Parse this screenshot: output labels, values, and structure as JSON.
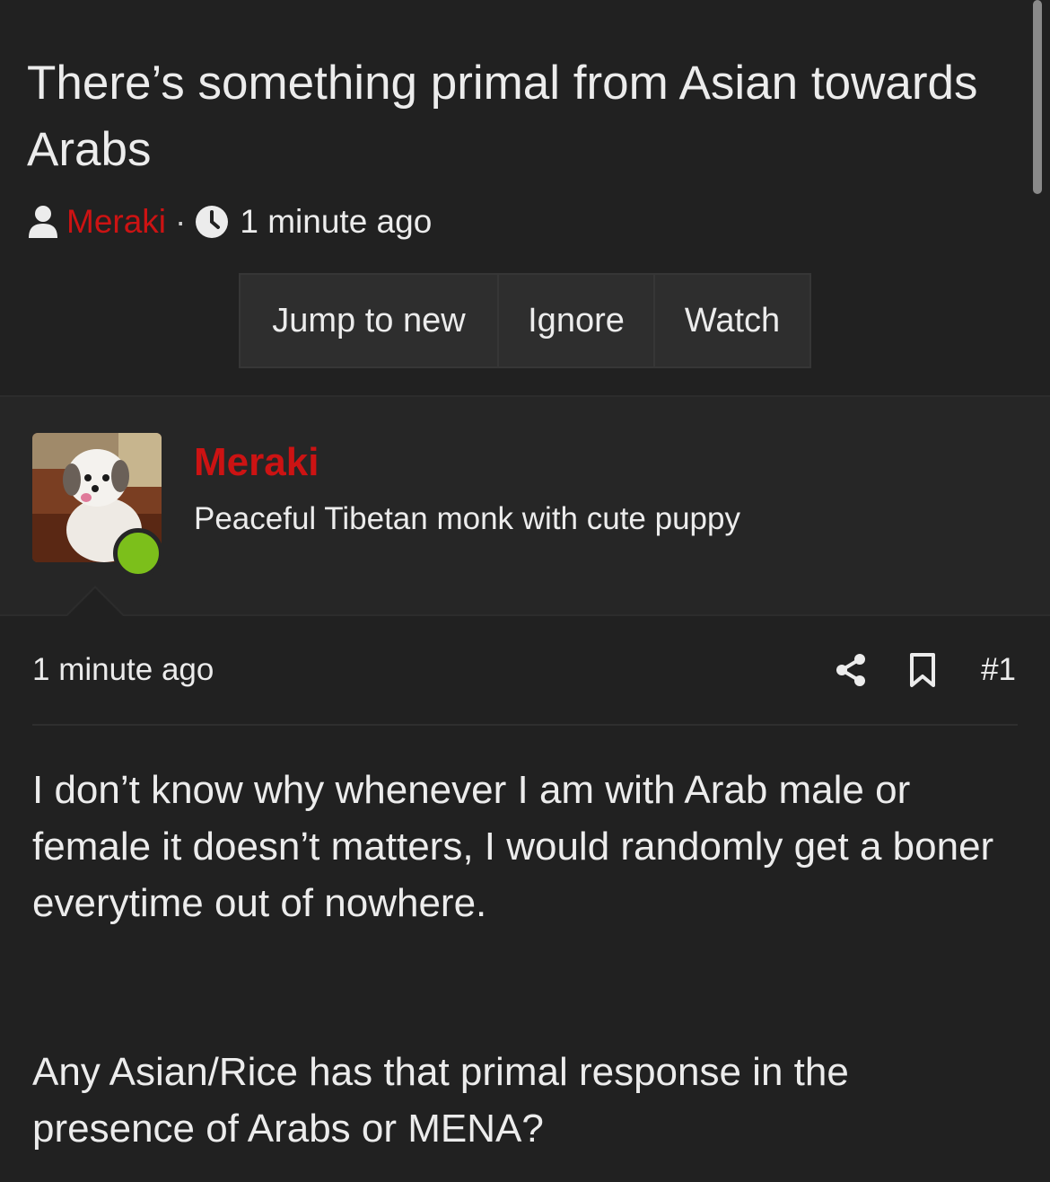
{
  "thread": {
    "title": "There’s something primal from Asian towards Arabs",
    "author": "Meraki",
    "separator": "·",
    "time": "1 minute ago"
  },
  "actions": {
    "jump_label": "Jump to new",
    "ignore_label": "Ignore",
    "watch_label": "Watch"
  },
  "post": {
    "author": "Meraki",
    "user_title": "Peaceful Tibetan monk with cute puppy",
    "online": true,
    "time": "1 minute ago",
    "number": "#1",
    "body_paragraph_1": "I don’t know why whenever I am with Arab male or female it doesn’t matters, I would randomly get a boner everytime out of nowhere.",
    "body_paragraph_2": "Any Asian/Rice has that primal response in the presence of Arabs or MENA?"
  },
  "colors": {
    "background": "#212121",
    "author_accent": "#cc1313",
    "online": "#7cbf1b"
  },
  "icons": [
    "user-icon",
    "clock-icon",
    "share-icon",
    "bookmark-icon"
  ]
}
